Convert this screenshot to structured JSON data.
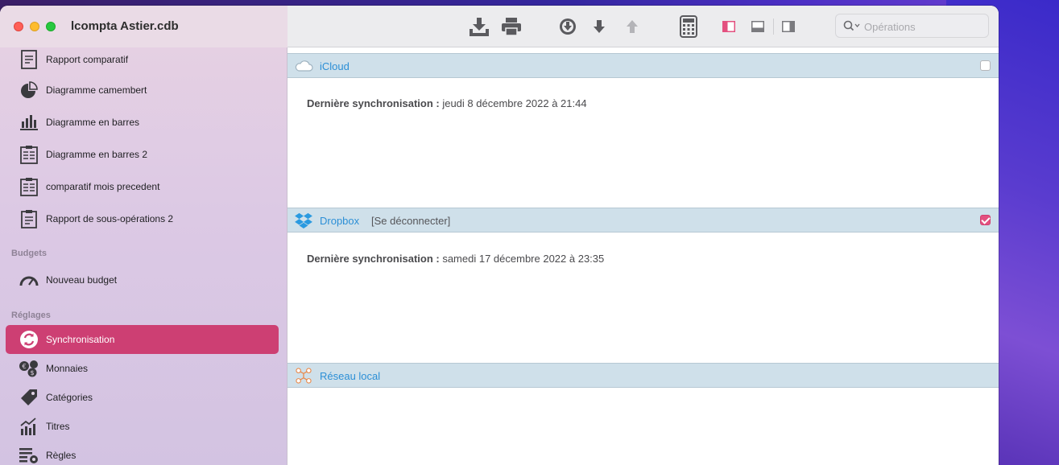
{
  "window": {
    "title": "lcompta Astier.cdb"
  },
  "toolbar": {
    "icons": [
      "import-icon",
      "print-icon",
      "download-circle-icon",
      "arrow-down-icon",
      "arrow-up-icon",
      "calculator-icon",
      "layout-left-icon",
      "layout-bottom-icon",
      "layout-right-icon"
    ],
    "search_placeholder": "Opérations"
  },
  "sidebar": {
    "items_top": [
      {
        "label": "Rapport comparatif",
        "icon": "report-icon"
      },
      {
        "label": "Diagramme camembert",
        "icon": "pie-chart-icon"
      },
      {
        "label": "Diagramme en barres",
        "icon": "bar-chart-icon"
      },
      {
        "label": "Diagramme en barres 2",
        "icon": "clipboard-icon"
      },
      {
        "label": "comparatif mois precedent",
        "icon": "clipboard-icon"
      },
      {
        "label": "Rapport de sous-opérations 2",
        "icon": "report-icon"
      }
    ],
    "section_budgets": "Budgets",
    "budget_items": [
      {
        "label": "Nouveau budget",
        "icon": "gauge-icon"
      }
    ],
    "section_reglages": "Réglages",
    "reglages_items": [
      {
        "label": "Synchronisation",
        "icon": "sync-icon",
        "selected": true
      },
      {
        "label": "Monnaies",
        "icon": "coins-icon"
      },
      {
        "label": "Catégories",
        "icon": "tag-icon"
      },
      {
        "label": "Titres",
        "icon": "stocks-icon"
      },
      {
        "label": "Règles",
        "icon": "rules-icon"
      }
    ]
  },
  "sync": {
    "icloud": {
      "title": "iCloud",
      "checked": false,
      "last_sync_label": "Dernière synchronisation :",
      "last_sync_value": " jeudi 8 décembre 2022 à 21:44"
    },
    "dropbox": {
      "title": "Dropbox",
      "action": "[Se déconnecter]",
      "checked": true,
      "last_sync_label": "Dernière synchronisation :",
      "last_sync_value": " samedi 17 décembre 2022 à 23:35"
    },
    "local": {
      "title": "Réseau local"
    }
  },
  "colors": {
    "accent": "#cd3f73",
    "header_bg": "#cfe0ea",
    "link": "#2c8fd6"
  }
}
